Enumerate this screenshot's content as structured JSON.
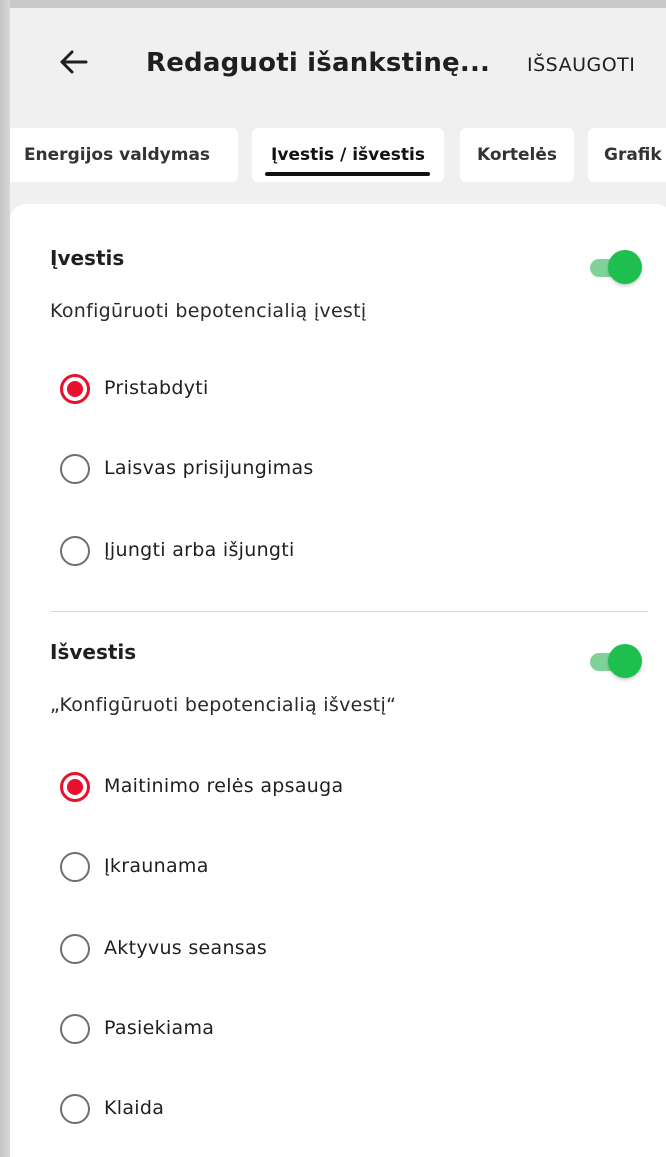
{
  "appbar": {
    "back_icon": "arrow-left-icon",
    "title": "Redaguoti išankstinę...",
    "save_label": "IŠSAUGOTI"
  },
  "tabs": [
    {
      "label": "Energijos valdymas",
      "selected": false
    },
    {
      "label": "Įvestis / išvestis",
      "selected": true
    },
    {
      "label": "Kortelės",
      "selected": false
    },
    {
      "label": "Grafik",
      "selected": false
    }
  ],
  "input_section": {
    "title": "Įvestis",
    "toggle_on": true,
    "description": "Konfigūruoti bepotencialią įvestį",
    "options": [
      {
        "label": "Pristabdyti",
        "checked": true
      },
      {
        "label": "Laisvas prisijungimas",
        "checked": false
      },
      {
        "label": "Įjungti arba išjungti",
        "checked": false
      }
    ]
  },
  "output_section": {
    "title": "Išvestis",
    "toggle_on": true,
    "description": "„Konfigūruoti bepotencialią išvestį“",
    "options": [
      {
        "label": "Maitinimo relės apsauga",
        "checked": true
      },
      {
        "label": "Įkraunama",
        "checked": false
      },
      {
        "label": "Aktyvus seansas",
        "checked": false
      },
      {
        "label": "Pasiekiama",
        "checked": false
      },
      {
        "label": "Klaida",
        "checked": false
      }
    ]
  },
  "colors": {
    "accent_red": "#e8112d",
    "toggle_green": "#1fbf4f",
    "toggle_track": "#7fd39a",
    "background": "#f0f0f0"
  }
}
